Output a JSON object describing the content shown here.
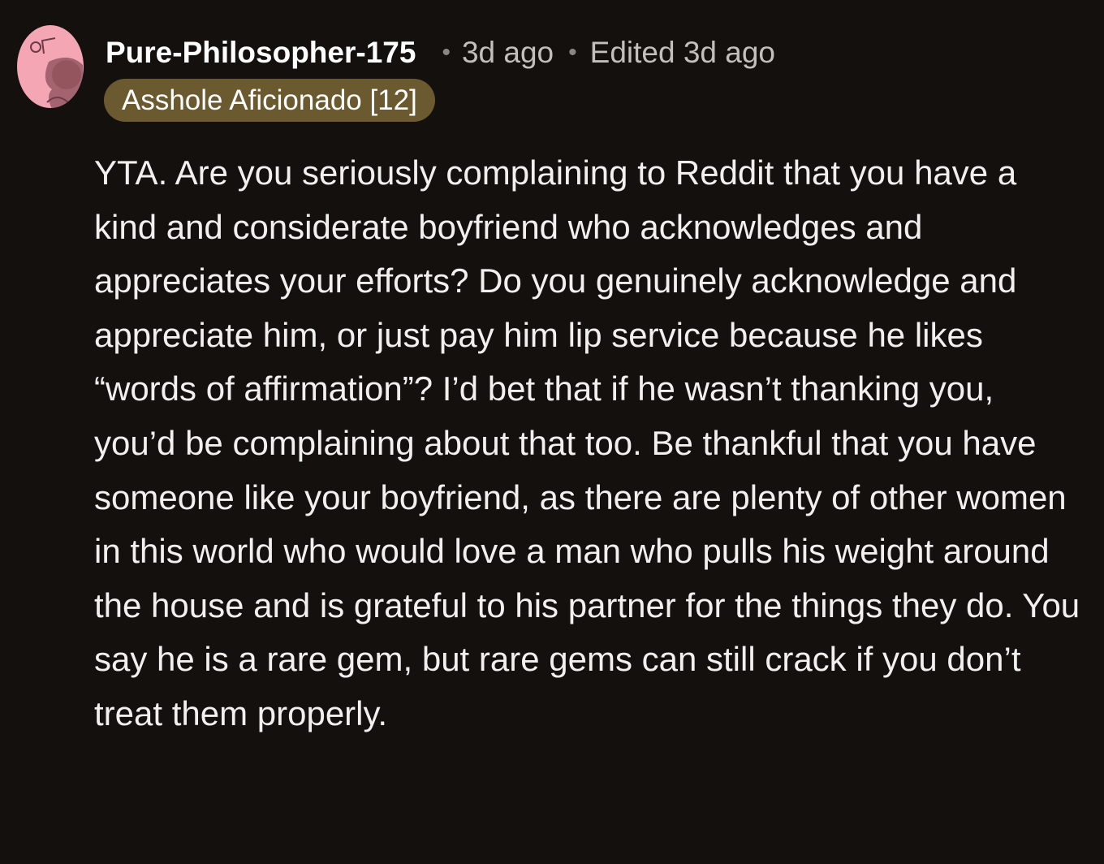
{
  "comment": {
    "author": "Pure-Philosopher-175",
    "separator": "•",
    "posted": "3d ago",
    "edited": "Edited 3d ago",
    "flair": "Asshole Aficionado [12]",
    "body": "YTA. Are you seriously complaining to Reddit that you have a kind and considerate boyfriend who acknowledges and appreciates your efforts? Do you genuinely acknowledge and appreciate him, or just pay him lip service because he likes “words of affirmation”? I’d bet that if he wasn’t thanking you, you’d be complaining about that too. Be thankful that you have someone like your boyfriend, as there are plenty of other women in this world who would love a man who pulls his weight around the house and is grateful to his partner for the things they do. You say he is a rare gem, but rare gems can still crack if you don’t treat them properly."
  },
  "colors": {
    "background": "#14100e",
    "flair_background": "#6b5930",
    "avatar_background": "#f4a6b5",
    "meta_text": "#c3bfbb"
  },
  "icons": {
    "avatar": "snoo-avatar-icon"
  }
}
